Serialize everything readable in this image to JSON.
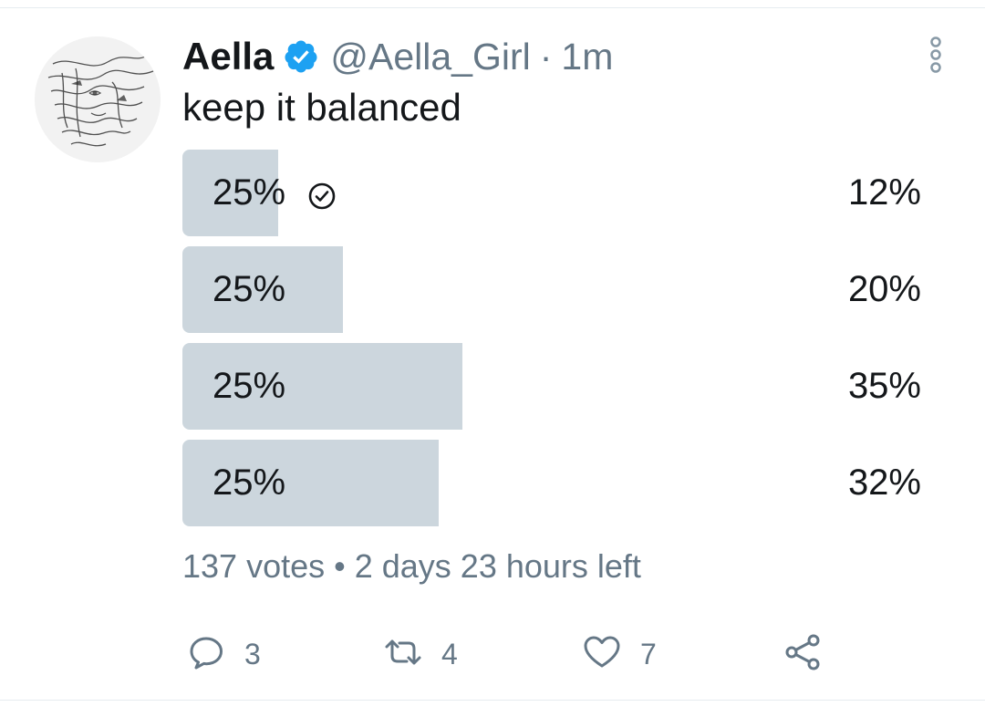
{
  "tweet": {
    "display_name": "Aella",
    "handle": "@Aella_Girl",
    "separator": "·",
    "time": "1m",
    "text": "keep it balanced"
  },
  "poll": {
    "options": [
      {
        "label": "25%",
        "percent": "12%",
        "fill": 0.12,
        "selected": true
      },
      {
        "label": "25%",
        "percent": "20%",
        "fill": 0.2,
        "selected": false
      },
      {
        "label": "25%",
        "percent": "35%",
        "fill": 0.35,
        "selected": false
      },
      {
        "label": "25%",
        "percent": "32%",
        "fill": 0.32,
        "selected": false
      }
    ],
    "votes": "137 votes",
    "bullet": "•",
    "time_left": "2 days 23 hours left"
  },
  "actions": {
    "reply_count": "3",
    "retweet_count": "4",
    "like_count": "7"
  },
  "icons": [
    "verified-badge-icon",
    "more-options-icon",
    "check-icon",
    "reply-icon",
    "retweet-icon",
    "like-icon",
    "share-icon"
  ],
  "colors": {
    "verified": "#1da1f2",
    "bar": "#ccd6dd",
    "muted": "#657786",
    "text": "#14171a"
  }
}
